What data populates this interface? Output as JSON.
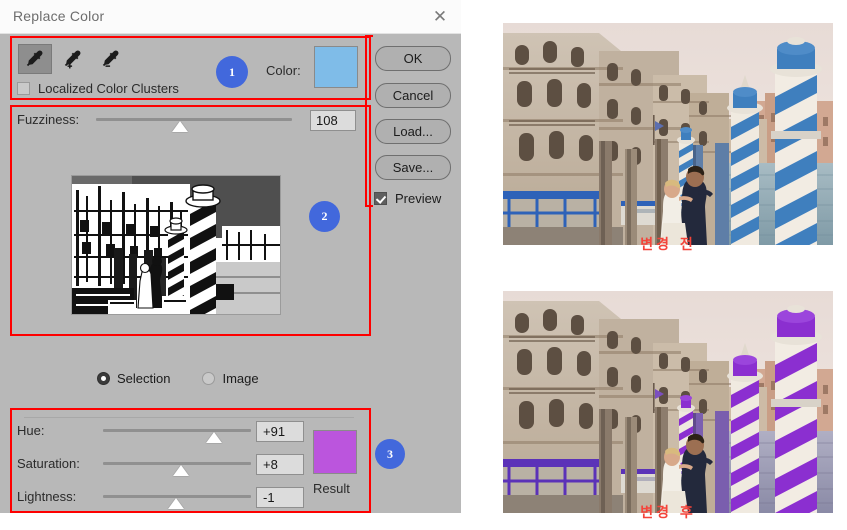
{
  "dialog": {
    "title": "Replace Color",
    "close_icon": "close-icon",
    "section1": {
      "tools": [
        {
          "name": "eyedropper-base",
          "glyph": "eyedropper",
          "selected": true
        },
        {
          "name": "eyedropper-add",
          "glyph": "eyedropper-plus",
          "selected": false
        },
        {
          "name": "eyedropper-subtract",
          "glyph": "eyedropper-minus",
          "selected": false
        }
      ],
      "localized_color_clusters": {
        "label": "Localized Color Clusters",
        "checked": false
      },
      "color": {
        "label": "Color:",
        "swatch_hex": "#7fbce8"
      },
      "badge": "1"
    },
    "section2": {
      "fuzziness": {
        "label": "Fuzziness:",
        "value": "108",
        "slider_percent": 43
      },
      "badge": "2"
    },
    "preview_mode": {
      "selection": {
        "label": "Selection",
        "checked": true
      },
      "image": {
        "label": "Image",
        "checked": false
      }
    },
    "section3": {
      "rows": [
        {
          "label": "Hue:",
          "value": "+91",
          "slider_percent": 75
        },
        {
          "label": "Saturation:",
          "value": "+8",
          "slider_percent": 53
        },
        {
          "label": "Lightness:",
          "value": "-1",
          "slider_percent": 49
        }
      ],
      "result": {
        "label": "Result",
        "swatch_hex": "#bb55dd"
      },
      "badge": "3"
    },
    "buttons": {
      "ok": "OK",
      "cancel": "Cancel",
      "load": "Load...",
      "save": "Save...",
      "preview": {
        "label": "Preview",
        "checked": true
      }
    }
  },
  "photos": {
    "before": {
      "caption": "변경 전",
      "description": "venice-canal-wedding-couple-blue-poles"
    },
    "after": {
      "caption": "변경 후",
      "description": "venice-canal-wedding-couple-purple-poles"
    }
  },
  "colors": {
    "badge": "#4268dc",
    "annotation_box": "#fe0000",
    "caption": "#f4443a",
    "dialog_bg": "#b8b8b8",
    "titlebar_bg": "#fbfbfb"
  }
}
